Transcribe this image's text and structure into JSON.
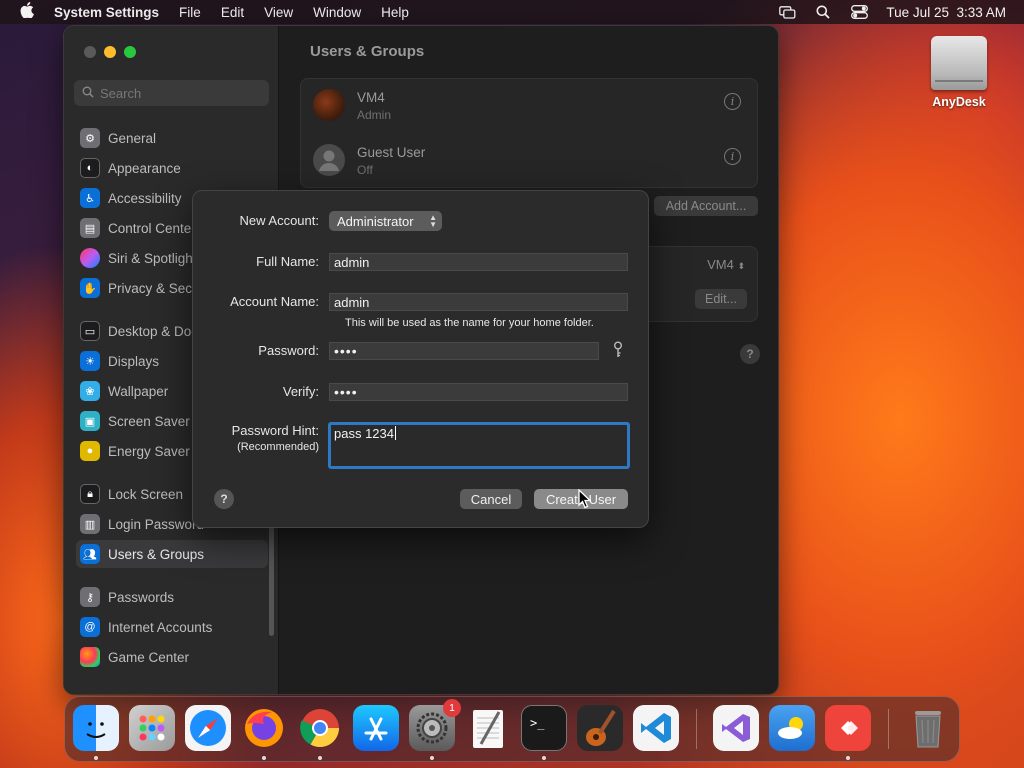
{
  "menubar": {
    "app_name": "System Settings",
    "menus": [
      "File",
      "Edit",
      "View",
      "Window",
      "Help"
    ],
    "datetime": "Tue Jul 25  3:33 AM",
    "status_icons": [
      "screen-mirroring-icon",
      "search-icon",
      "control-center-icon"
    ]
  },
  "desktop": {
    "icon_label": "AnyDesk"
  },
  "settings": {
    "search_placeholder": "Search",
    "sidebar": [
      {
        "label": "General",
        "icon": "gear-icon",
        "color": "#8e8e93"
      },
      {
        "label": "Appearance",
        "icon": "appearance-icon",
        "color": "#1c1c1e"
      },
      {
        "label": "Accessibility",
        "icon": "accessibility-icon",
        "color": "#0a84ff"
      },
      {
        "label": "Control Center",
        "icon": "control-center-icon",
        "color": "#8e8e93"
      },
      {
        "label": "Siri & Spotlight",
        "icon": "siri-icon",
        "color": "#bf5af2"
      },
      {
        "label": "Privacy & Security",
        "icon": "hand-icon",
        "color": "#0a84ff"
      },
      {
        "label": "Desktop & Dock",
        "icon": "dock-icon",
        "color": "#1c1c1e"
      },
      {
        "label": "Displays",
        "icon": "sun-icon",
        "color": "#0a84ff"
      },
      {
        "label": "Wallpaper",
        "icon": "wallpaper-icon",
        "color": "#32ade6"
      },
      {
        "label": "Screen Saver",
        "icon": "screen-saver-icon",
        "color": "#30b0c7"
      },
      {
        "label": "Energy Saver",
        "icon": "bulb-icon",
        "color": "#ffd60a"
      },
      {
        "label": "Lock Screen",
        "icon": "lock-icon",
        "color": "#1c1c1e"
      },
      {
        "label": "Login Password",
        "icon": "password-icon",
        "color": "#8e8e93"
      },
      {
        "label": "Users & Groups",
        "icon": "users-icon",
        "color": "#0a84ff"
      },
      {
        "label": "Passwords",
        "icon": "key-icon",
        "color": "#8e8e93"
      },
      {
        "label": "Internet Accounts",
        "icon": "at-icon",
        "color": "#0a84ff"
      },
      {
        "label": "Game Center",
        "icon": "game-center-icon",
        "color": "#ff375f"
      }
    ],
    "selected": "Users & Groups",
    "main": {
      "title": "Users & Groups",
      "users": [
        {
          "name": "VM4",
          "role": "Admin"
        },
        {
          "name": "Guest User",
          "role": "Off"
        }
      ],
      "add_account": "Add Account...",
      "auto_login_value": "VM4",
      "edit": "Edit...",
      "help": "?"
    }
  },
  "dialog": {
    "new_account_label": "New Account:",
    "new_account_value": "Administrator",
    "full_name_label": "Full Name:",
    "full_name_value": "admin",
    "account_name_label": "Account Name:",
    "account_name_value": "admin",
    "account_name_note": "This will be used as the name for your home folder.",
    "password_label": "Password:",
    "password_value": "••••",
    "verify_label": "Verify:",
    "verify_value": "••••",
    "hint_label": "Password Hint:",
    "hint_sublabel": "(Recommended)",
    "hint_value": "pass 1234",
    "help": "?",
    "cancel": "Cancel",
    "create": "Create User"
  },
  "dock": {
    "apps": [
      "Finder",
      "Launchpad",
      "Safari",
      "Firefox",
      "Chrome",
      "App Store",
      "System Settings",
      "TextEdit",
      "Terminal",
      "GarageBand",
      "Visual Studio Code",
      "Visual Studio",
      "Weather",
      "AnyDesk",
      "Trash"
    ],
    "system_settings_badge": "1"
  },
  "colors": {
    "accent": "#2f79c4",
    "close": "#ff5f57",
    "minimize": "#febc2e",
    "zoom": "#28c840"
  }
}
